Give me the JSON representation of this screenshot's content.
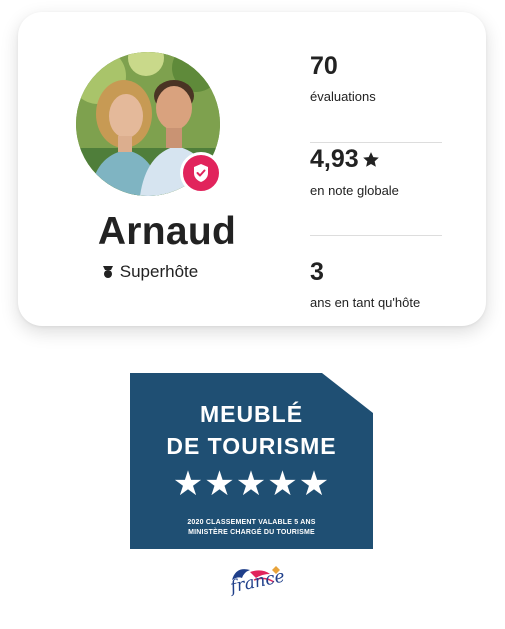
{
  "host": {
    "name": "Arnaud",
    "badge_label": "Superhôte",
    "stats": [
      {
        "value": "70",
        "label": "évaluations"
      },
      {
        "value": "4,93",
        "label": "en note globale",
        "icon": "star-icon"
      },
      {
        "value": "3",
        "label": "ans en tant qu'hôte"
      }
    ]
  },
  "tourism_badge": {
    "line1": "MEUBLÉ",
    "line2": "DE TOURISME",
    "stars": "★★★★★",
    "star_count": 5,
    "fine_print_1": "2020 CLASSEMENT VALABLE 5 ANS",
    "fine_print_2": "MINISTÈRE CHARGÉ DU TOURISME",
    "color": "#1f4f73"
  },
  "france_logo": {
    "text": "france"
  },
  "colors": {
    "accent": "#e1245c",
    "text": "#222222",
    "divider": "#dddddd"
  }
}
